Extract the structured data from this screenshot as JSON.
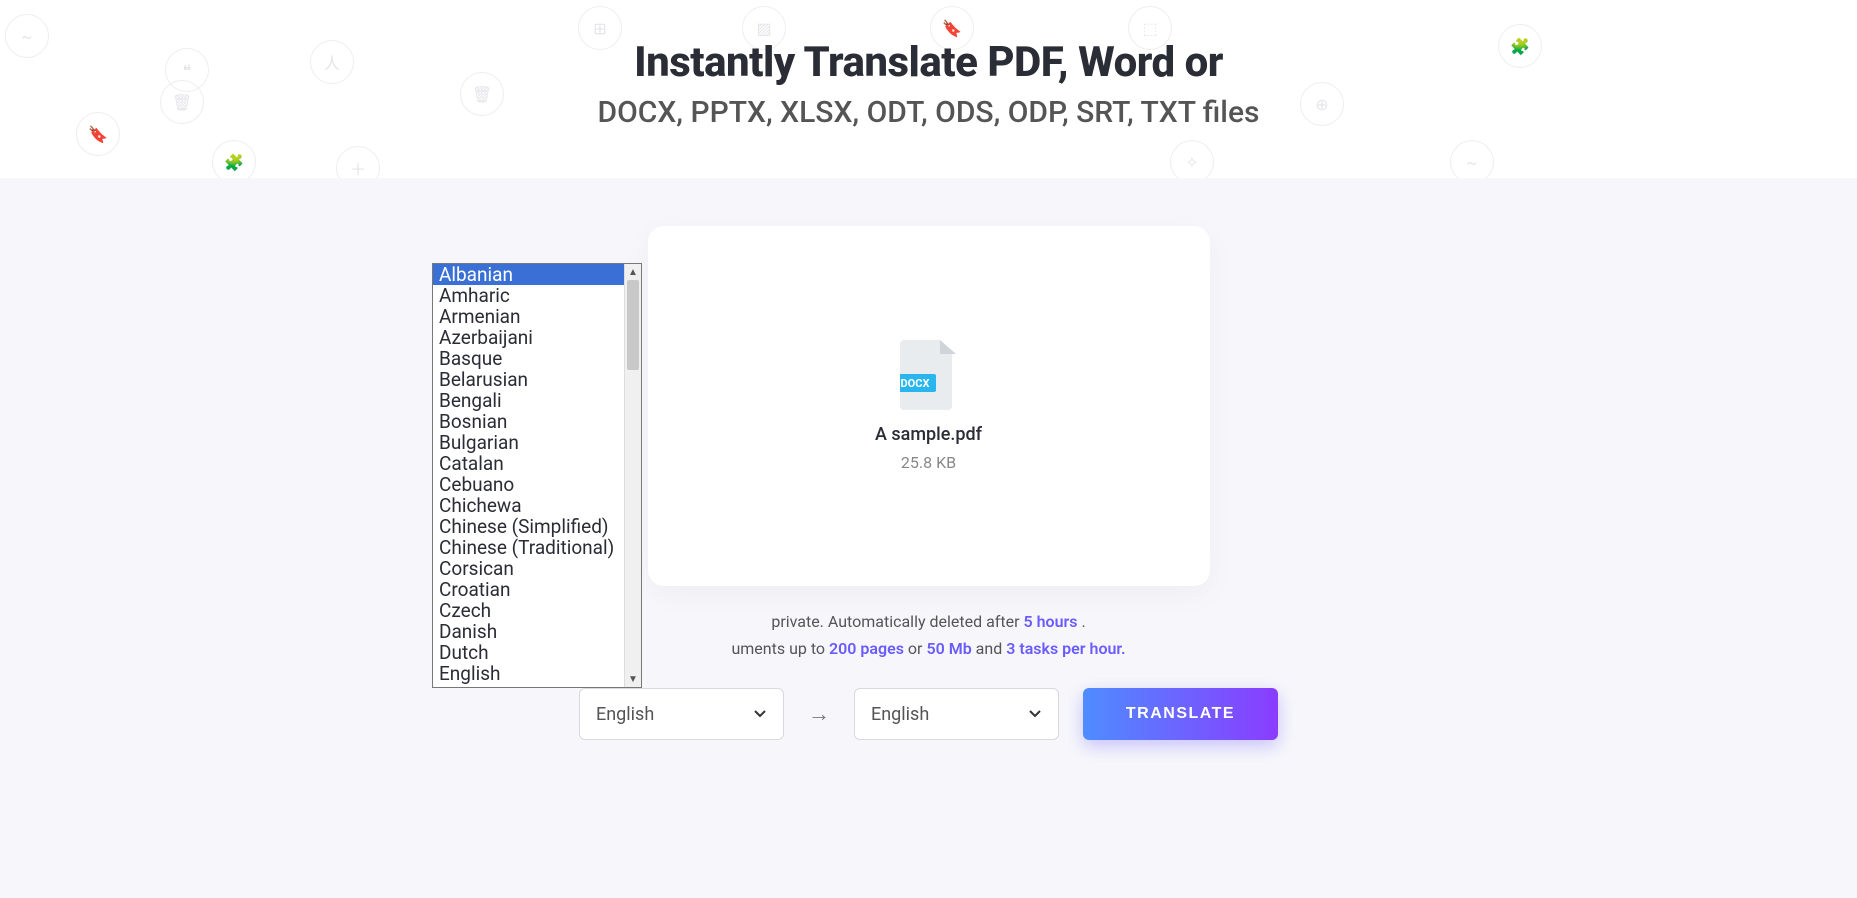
{
  "hero": {
    "title": "Instantly Translate PDF, Word or",
    "subtitle": "DOCX, PPTX, XLSX, ODT, ODS, ODP, SRT, TXT files"
  },
  "file": {
    "badge": "DOCX",
    "name": "A sample.pdf",
    "size": "25.8 KB"
  },
  "note": {
    "line1_a": " private. Automatically deleted after ",
    "line1_b": "5 hours",
    "line1_c": " .",
    "line2_a": "uments up to ",
    "line2_b": "200 pages",
    "line2_c": " or ",
    "line2_d": "50 Mb",
    "line2_e": " and ",
    "line2_f": "3 tasks per hour."
  },
  "controls": {
    "source_lang": "English",
    "target_lang": "English",
    "arrow": "→",
    "translate_label": "TRANSLATE"
  },
  "listbox": {
    "selected_index": 0,
    "options": [
      "Albanian",
      "Amharic",
      "Armenian",
      "Azerbaijani",
      "Basque",
      "Belarusian",
      "Bengali",
      "Bosnian",
      "Bulgarian",
      "Catalan",
      "Cebuano",
      "Chichewa",
      "Chinese (Simplified)",
      "Chinese (Traditional)",
      "Corsican",
      "Croatian",
      "Czech",
      "Danish",
      "Dutch",
      "English"
    ]
  },
  "decor_icons": [
    "❝",
    "⊞",
    "▨",
    "🔖",
    "⬚",
    "＋",
    "✧",
    "⬚",
    "⊕",
    "🧩",
    "↯",
    "🗑",
    "🧩",
    "＋"
  ]
}
